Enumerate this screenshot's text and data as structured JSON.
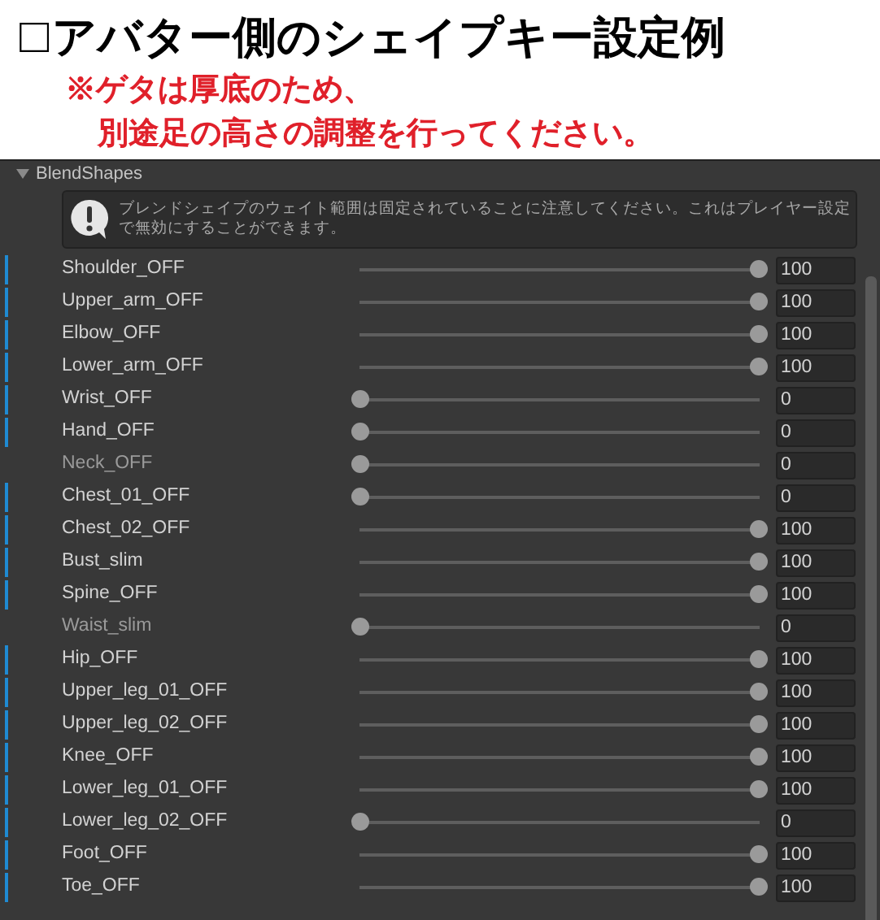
{
  "heading": {
    "checkbox": "□",
    "title": "アバター側のシェイプキー設定例",
    "note_lines": [
      "※ゲタは厚底のため、",
      "別途足の高さの調整を行ってください。"
    ]
  },
  "section": {
    "title": "BlendShapes",
    "expanded": true
  },
  "help_box": {
    "message": "ブレンドシェイプのウェイト範囲は固定されていることに注意してください。これはプレイヤー設定で無効にすることができます。"
  },
  "shapes": [
    {
      "name": "Shoulder_OFF",
      "overridden": true,
      "level": 1,
      "value": "100"
    },
    {
      "name": "Upper_arm_OFF",
      "overridden": true,
      "level": 1,
      "value": "100"
    },
    {
      "name": "Elbow_OFF",
      "overridden": true,
      "level": 1,
      "value": "100"
    },
    {
      "name": "Lower_arm_OFF",
      "overridden": true,
      "level": 1,
      "value": "100"
    },
    {
      "name": "Wrist_OFF",
      "overridden": true,
      "level": 0,
      "value": "0"
    },
    {
      "name": "Hand_OFF",
      "overridden": true,
      "level": 0,
      "value": "0"
    },
    {
      "name": "Neck_OFF",
      "overridden": false,
      "level": 0,
      "value": "0"
    },
    {
      "name": "Chest_01_OFF",
      "overridden": true,
      "level": 0,
      "value": "0"
    },
    {
      "name": "Chest_02_OFF",
      "overridden": true,
      "level": 1,
      "value": "100"
    },
    {
      "name": "Bust_slim",
      "overridden": true,
      "level": 1,
      "value": "100"
    },
    {
      "name": "Spine_OFF",
      "overridden": true,
      "level": 1,
      "value": "100"
    },
    {
      "name": "Waist_slim",
      "overridden": false,
      "level": 0,
      "value": "0"
    },
    {
      "name": "Hip_OFF",
      "overridden": true,
      "level": 1,
      "value": "100"
    },
    {
      "name": "Upper_leg_01_OFF",
      "overridden": true,
      "level": 1,
      "value": "100"
    },
    {
      "name": "Upper_leg_02_OFF",
      "overridden": true,
      "level": 1,
      "value": "100"
    },
    {
      "name": "Knee_OFF",
      "overridden": true,
      "level": 1,
      "value": "100"
    },
    {
      "name": "Lower_leg_01_OFF",
      "overridden": true,
      "level": 1,
      "value": "100"
    },
    {
      "name": "Lower_leg_02_OFF",
      "overridden": true,
      "level": 0,
      "value": "0"
    },
    {
      "name": "Foot_OFF",
      "overridden": true,
      "level": 1,
      "value": "100"
    },
    {
      "name": "Toe_OFF",
      "overridden": true,
      "level": 1,
      "value": "100"
    }
  ]
}
